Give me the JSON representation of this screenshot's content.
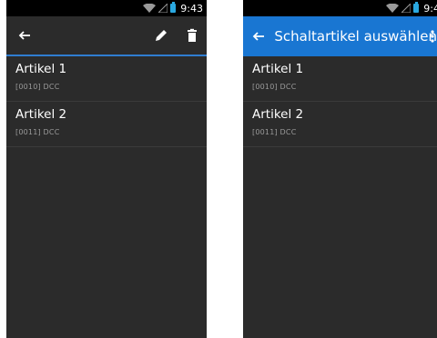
{
  "status_bar": {
    "time": "9:43",
    "battery_color": "#2aa8e0"
  },
  "left_screen": {
    "toolbar": {
      "back_icon": "arrow-left-icon",
      "edit_icon": "pencil-icon",
      "delete_icon": "trash-icon",
      "divider_color": "#2f7dd1"
    },
    "items": [
      {
        "title": "Artikel 1",
        "subtitle": "[0010]  DCC"
      },
      {
        "title": "Artikel 2",
        "subtitle": "[0011]  DCC"
      }
    ]
  },
  "right_screen": {
    "toolbar": {
      "back_icon": "arrow-left-icon",
      "title": "Schaltartikel auswählen",
      "menu_icon": "overflow-menu-icon",
      "color": "#1976d2"
    },
    "items": [
      {
        "title": "Artikel 1",
        "subtitle": "[0010]  DCC"
      },
      {
        "title": "Artikel 2",
        "subtitle": "[0011]  DCC"
      }
    ]
  }
}
